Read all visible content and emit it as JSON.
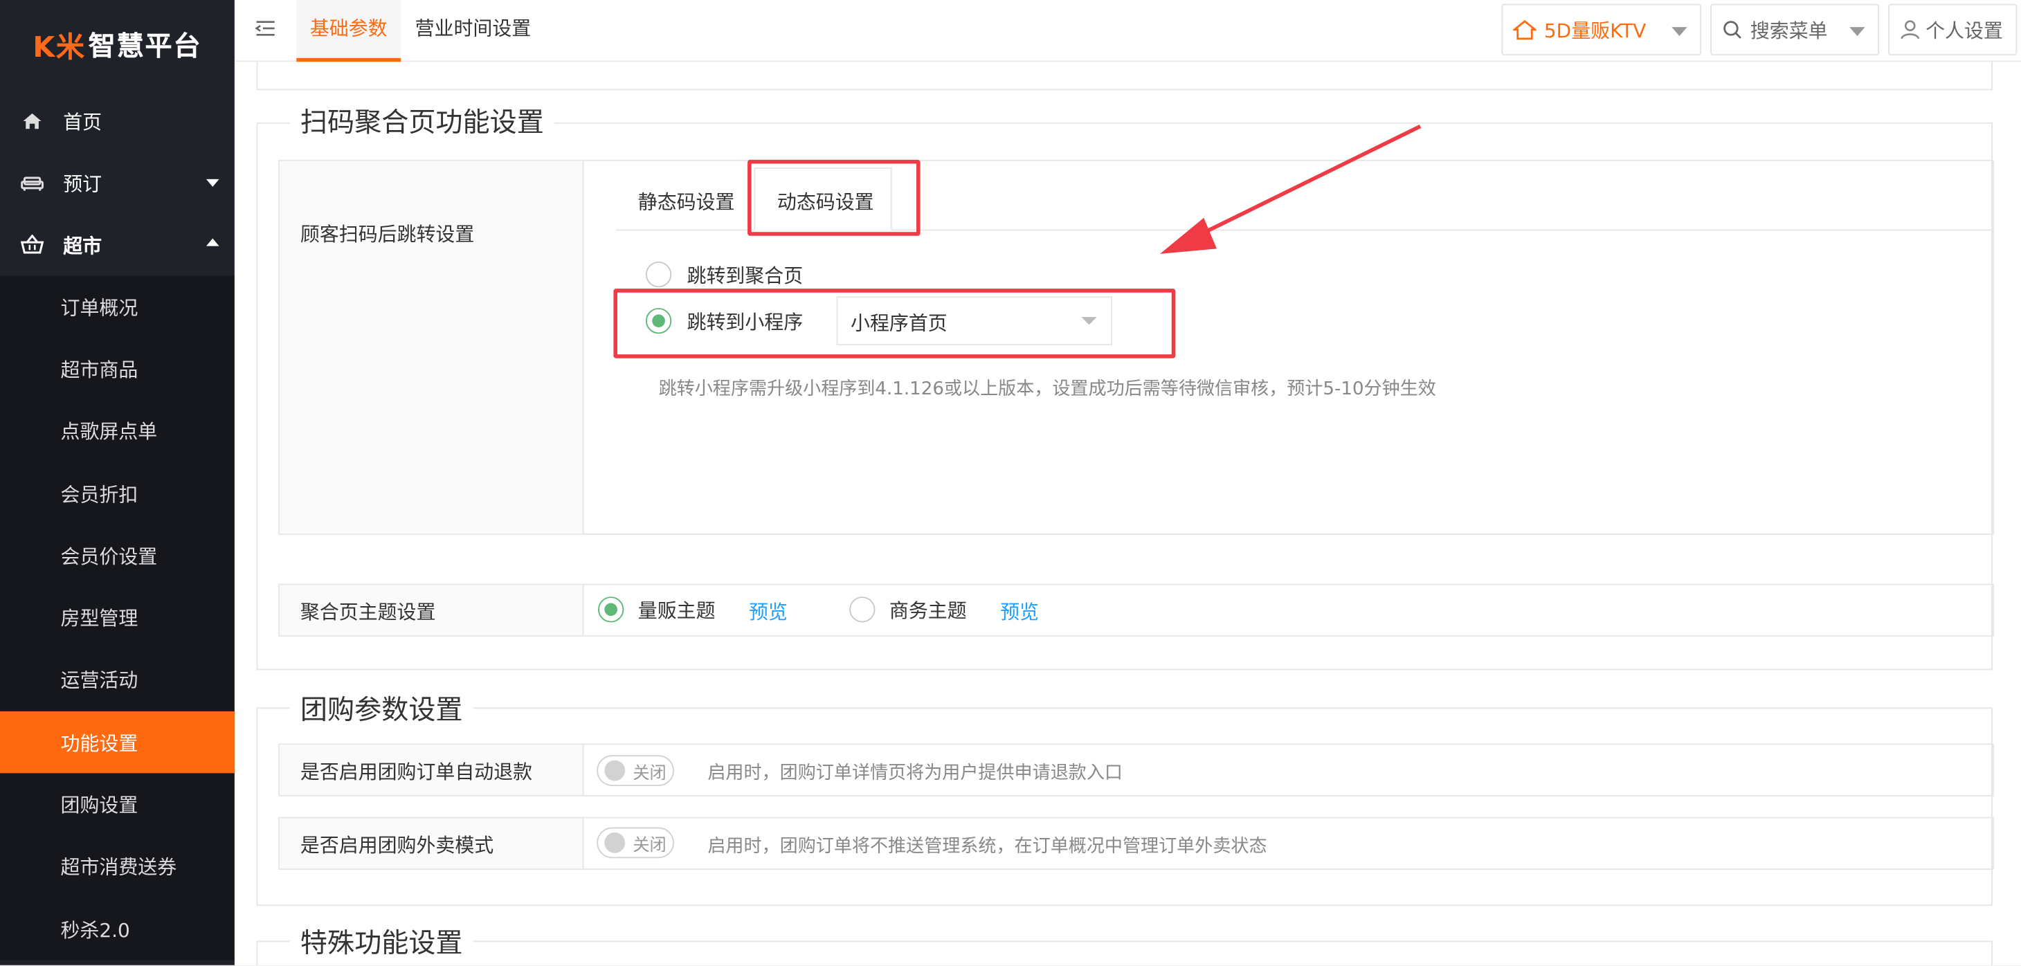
{
  "sidebar": {
    "logo_mark": "K米",
    "logo_text": "智慧平台",
    "items": [
      {
        "label": "首页"
      },
      {
        "label": "预订"
      },
      {
        "label": "超市"
      }
    ],
    "submenu": [
      {
        "label": "订单概况"
      },
      {
        "label": "超市商品"
      },
      {
        "label": "点歌屏点单"
      },
      {
        "label": "会员折扣"
      },
      {
        "label": "会员价设置"
      },
      {
        "label": "房型管理"
      },
      {
        "label": "运营活动"
      },
      {
        "label": "功能设置"
      },
      {
        "label": "团购设置"
      },
      {
        "label": "超市消费送券"
      },
      {
        "label": "秒杀2.0"
      }
    ]
  },
  "topbar": {
    "tabs": [
      {
        "label": "基础参数"
      },
      {
        "label": "营业时间设置"
      }
    ],
    "store": "5D量贩KTV",
    "search": "搜索菜单",
    "profile": "个人设置"
  },
  "scan_section": {
    "title": "扫码聚合页功能设置",
    "jump_label": "顾客扫码后跳转设置",
    "tabs": [
      {
        "label": "静态码设置"
      },
      {
        "label": "动态码设置"
      }
    ],
    "option_aggregate": "跳转到聚合页",
    "option_miniprogram": "跳转到小程序",
    "miniprogram_select": "小程序首页",
    "hint": "跳转小程序需升级小程序到4.1.126或以上版本，设置成功后需等待微信审核，预计5-10分钟生效",
    "theme_label": "聚合页主题设置",
    "theme_1": "量贩主题",
    "theme_2": "商务主题",
    "preview": "预览"
  },
  "group_section": {
    "title": "团购参数设置",
    "refund_label": "是否启用团购订单自动退款",
    "refund_hint": "启用时，团购订单详情页将为用户提供申请退款入口",
    "takeout_label": "是否启用团购外卖模式",
    "takeout_hint": "启用时，团购订单将不推送管理系统，在订单概况中管理订单外卖状态",
    "switch_off": "关闭"
  },
  "special_section": {
    "title": "特殊功能设置"
  },
  "colors": {
    "accent": "#ff6a10",
    "sidebar_bg": "#20222a",
    "radio_on": "#5fb878",
    "link": "#1e9fff",
    "annotation": "#ee3b45"
  }
}
